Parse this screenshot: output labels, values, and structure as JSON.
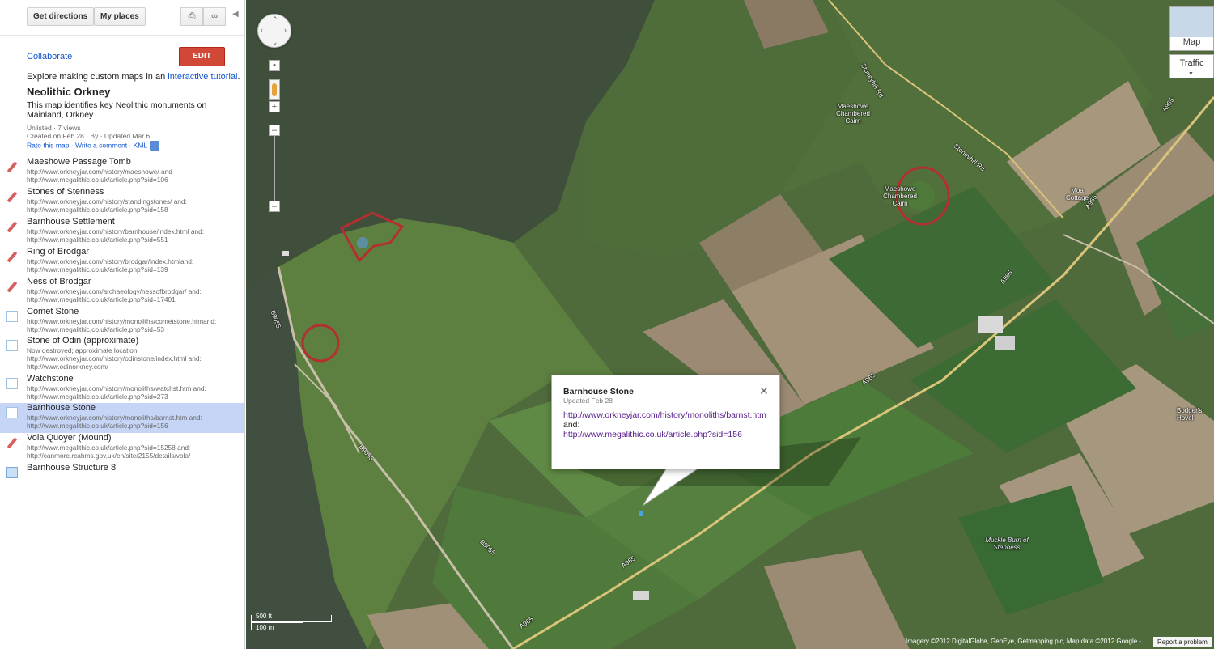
{
  "sidebar": {
    "get_directions": "Get directions",
    "my_places": "My places",
    "collaborate": "Collaborate",
    "edit": "EDIT",
    "explore_prefix": "Explore making custom maps in an ",
    "explore_link": "interactive tutorial",
    "explore_suffix": ".",
    "map_title": "Neolithic Orkney",
    "map_description": "This map identifies key Neolithic monuments on Mainland, Orkney",
    "meta_views": "Unlisted · 7 views",
    "meta_created": "Created on Feb 28 · By  · Updated Mar 6",
    "rate": "Rate this map",
    "comment": "Write a comment",
    "kml": "KML",
    "items": [
      {
        "name": "Maeshowe Passage Tomb",
        "desc": "http://www.orkneyjar.com/history/maeshowe/ and http://www.megalithic.co.uk/article.php?sid=106",
        "icon": "pencil-icon"
      },
      {
        "name": "Stones of Stenness",
        "desc": "http://www.orkneyjar.com/history/standingstones/ and: http://www.megalithic.co.uk/article.php?sid=158",
        "icon": "pencil-icon"
      },
      {
        "name": "Barnhouse Settlement",
        "desc": "http://www.orkneyjar.com/history/barnhouse/index.html and: http://www.megalithic.co.uk/article.php?sid=551",
        "icon": "pencil-icon"
      },
      {
        "name": "Ring of Brodgar",
        "desc": "http://www.orkneyjar.com/history/brodgar/index.htmland: http://www.megalithic.co.uk/article.php?sid=139",
        "icon": "pencil-icon"
      },
      {
        "name": "Ness of Brodgar",
        "desc": "http://www.orkneyjar.com/archaeology/nessofbrodgar/ and: http://www.megalithic.co.uk/article.php?sid=17401",
        "icon": "pencil-icon"
      },
      {
        "name": "Comet Stone",
        "desc": "http://www.orkneyjar.com/history/monoliths/cometstone.htmand: http://www.megalithic.co.uk/article.php?sid=53",
        "icon": "marker-box-icon"
      },
      {
        "name": "Stone of Odin (approximate)",
        "desc": "Now destroyed; approximate location: http://www.orkneyjar.com/history/odinstone/index.html and: http://www.odinorkney.com/",
        "icon": "marker-box-icon"
      },
      {
        "name": "Watchstone",
        "desc": "http://www.orkneyjar.com/history/monoliths/watchst.htm and: http://www.megalithic.co.uk/article.php?sid=273",
        "icon": "marker-box-icon"
      },
      {
        "name": "Barnhouse Stone",
        "desc": "http://www.orkneyjar.com/history/monoliths/barnst.htm and: http://www.megalithic.co.uk/article.php?sid=156",
        "icon": "marker-box-icon",
        "selected": true
      },
      {
        "name": "Vola Quoyer (Mound)",
        "desc": "http://www.megalithic.co.uk/article.php?sid=15258 and: http://canmore.rcahms.gov.uk/en/site/2155/details/vola/",
        "icon": "pencil-icon"
      },
      {
        "name": "Barnhouse Structure 8",
        "desc": "",
        "icon": "filled-box-icon"
      }
    ]
  },
  "map": {
    "map_type": "Map",
    "traffic": "Traffic",
    "scale_ft": "500 ft",
    "scale_m": "100 m",
    "attribution": "Imagery ©2012 DigitalGlobe, GeoEye, Getmapping plc, Map data ©2012 Google -",
    "report": "Report a problem",
    "labels": {
      "maeshowe_top": "Maeshowe Chambered Cairn",
      "maeshowe_mid": "Maeshowe Chambered Cairn",
      "moa": "Moa Cottage",
      "bodger": "Bodger's Hovel",
      "muckle": "Muckle Burn of Stenness",
      "road_stoneyhill1": "Stoneyhill Rd",
      "road_stoneyhill2": "Stoneyhill Rd",
      "road_a965_1": "A965",
      "road_a965_2": "A965",
      "road_a965_3": "A965",
      "road_a965_4": "A965",
      "road_a965_5": "A965",
      "road_a965_6": "A965",
      "road_b9055_1": "B9055",
      "road_b9055_2": "B9055",
      "road_b9055_3": "B9055"
    },
    "popup": {
      "title": "Barnhouse Stone",
      "updated": "Updated Feb 28",
      "link1": "http://www.orkneyjar.com/history/monoliths/barnst.htm",
      "and": "and:",
      "link2": "http://www.megalithic.co.uk/article.php?sid=156"
    }
  }
}
